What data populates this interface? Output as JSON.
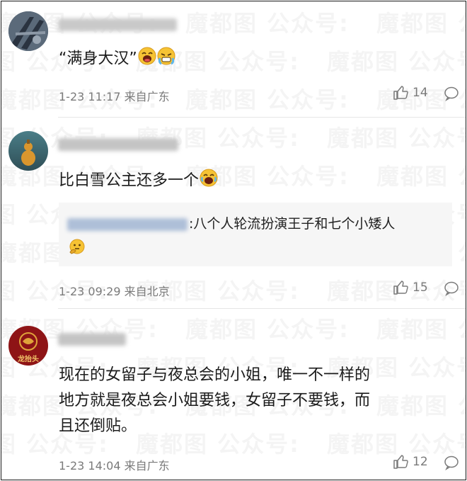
{
  "watermark": "魔都图 公众号:",
  "comments": [
    {
      "text": "“满身大汉”",
      "time": "1-23 11:17 来自广东",
      "likes": "14",
      "emojis": [
        "laughing-crying-emoji",
        "sweating-emoji"
      ]
    },
    {
      "text": "比白雪公主还多一个",
      "time": "1-23 09:29 来自北京",
      "likes": "15",
      "emojis": [
        "laughing-crying-emoji"
      ],
      "quote": {
        "text": ":八个人轮流扮演王子和七个小矮人",
        "emoji": "thinking-emoji"
      }
    },
    {
      "text_lines": [
        "现在的女留子与夜总会的小姐，唯一不一样的",
        "地方就是夜总会小姐要钱，女留子不要钱，而",
        "且还倒贴。"
      ],
      "time": "1-23 14:04 来自广东",
      "likes": "12",
      "avatar_text": "龙抬头"
    }
  ],
  "colors": {
    "text": "#1b1b1b",
    "meta": "#7a7a7a",
    "quote_bg": "#f6f6f6",
    "divider": "#e6e6e6"
  }
}
